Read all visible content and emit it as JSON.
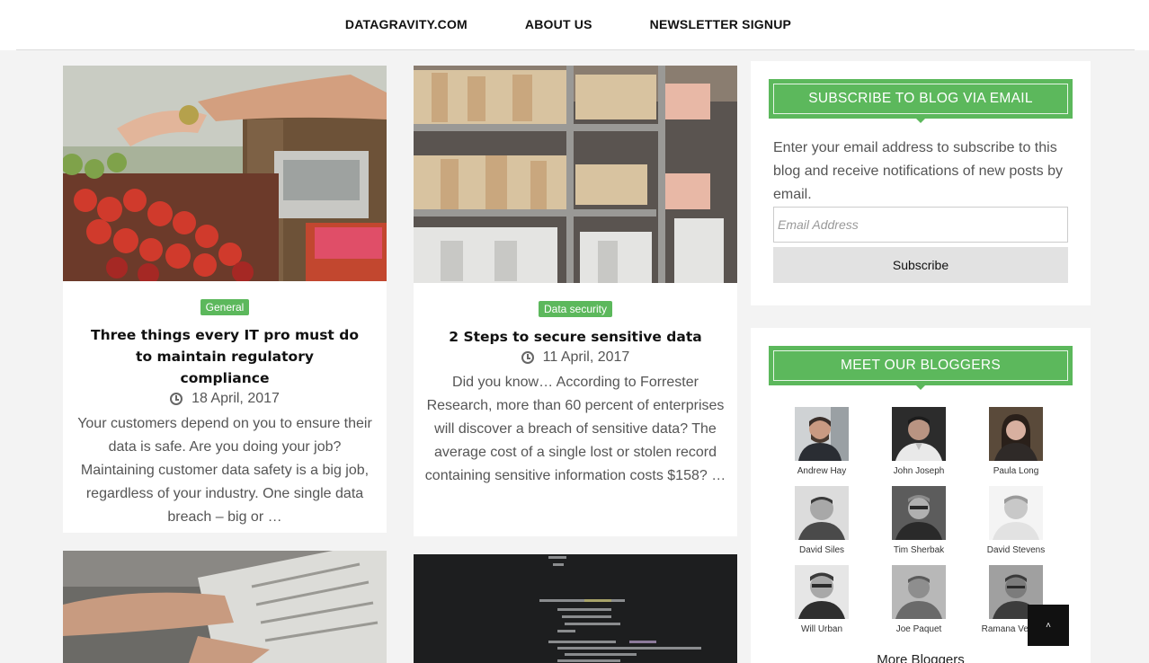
{
  "nav": {
    "items": [
      "DATAGRAVITY.COM",
      "ABOUT US",
      "NEWSLETTER SIGNUP"
    ]
  },
  "posts": [
    {
      "category": "General",
      "title": "Three things every IT pro must do to maintain regulatory compliance",
      "date": "18 April, 2017",
      "excerpt": "Your customers depend on you to ensure their data is safe. Are you doing your job? Maintaining customer data safety is a big job, regardless of your industry. One single data breach – big or …"
    },
    {
      "category": "Data security",
      "title": "2 Steps to secure sensitive data",
      "date": "11 April, 2017",
      "excerpt": "Did you know… According to Forrester Research, more than 60 percent of enterprises will discover a breach of sensitive data? The average cost of a single lost or stolen record containing sensitive information costs $158? …"
    }
  ],
  "subscribe": {
    "title": "SUBSCRIBE TO BLOG VIA EMAIL",
    "text": "Enter your email address to subscribe to this blog and receive notifications of new posts by email.",
    "email_placeholder": "Email Address",
    "button_label": "Subscribe"
  },
  "bloggers": {
    "title": "MEET OUR BLOGGERS",
    "people": [
      "Andrew Hay",
      "John Joseph",
      "Paula Long",
      "David Siles",
      "Tim Sherbak",
      "David Stevens",
      "Will Urban",
      "Joe Paquet",
      "Ramana Venkata"
    ],
    "more_label": "More Bloggers"
  },
  "colors": {
    "accent": "#5cb85c",
    "page_bg": "#f3f3f3"
  },
  "icons": {
    "date": "clock-icon",
    "back_to_top": "caret-up-icon"
  }
}
